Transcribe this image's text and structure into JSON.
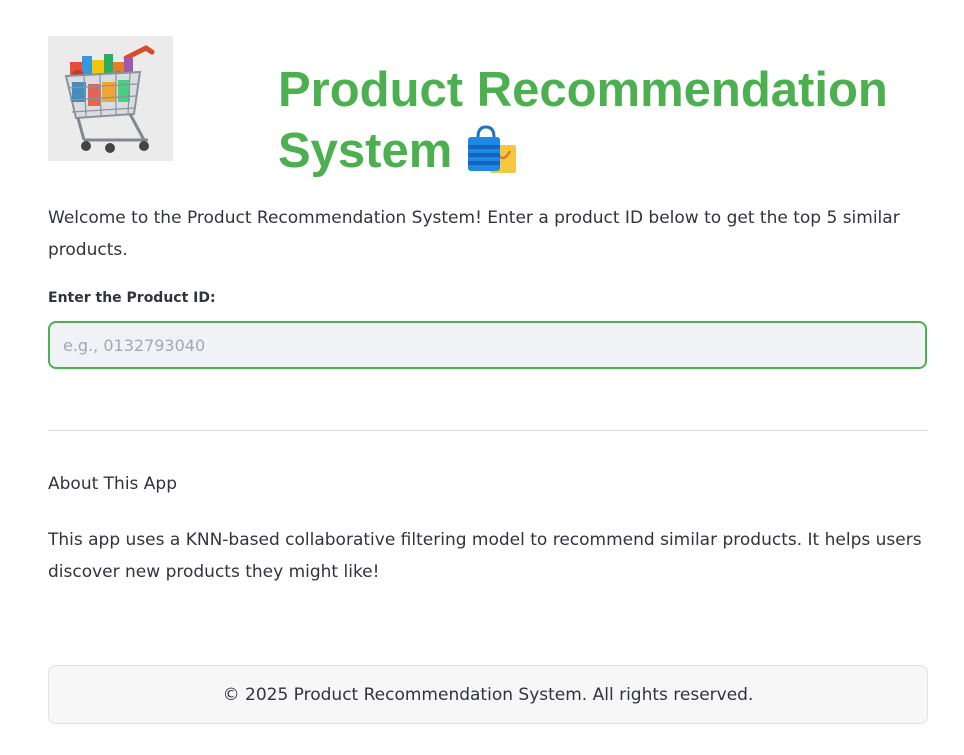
{
  "header": {
    "logo_alt": "Shopping cart filled with groceries",
    "title": "Product Recommendation System",
    "title_icon": "shopping-bags-icon"
  },
  "intro": {
    "welcome_text": "Welcome to the Product Recommendation System! Enter a product ID below to get the top 5 similar products."
  },
  "product_input": {
    "label": "Enter the Product ID:",
    "placeholder": "e.g., 0132793040",
    "value": ""
  },
  "about": {
    "heading": "About This App",
    "text": "This app uses a KNN-based collaborative filtering model to recommend similar products. It helps users discover new products they might like!"
  },
  "footer": {
    "text": "© 2025 Product Recommendation System. All rights reserved."
  },
  "colors": {
    "accent": "#4caf50",
    "text": "#31333f",
    "input_background": "#f0f2f6",
    "placeholder": "#a3a8b4"
  }
}
